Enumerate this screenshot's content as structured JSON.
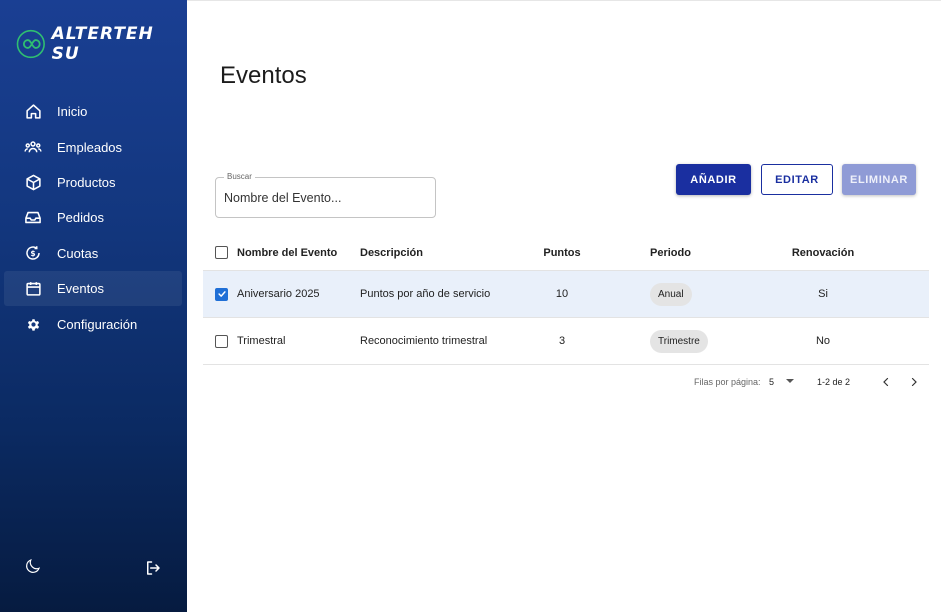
{
  "brand": {
    "name": "ALTERTEH SU",
    "accent": "#2fbf71"
  },
  "sidebar": {
    "items": [
      {
        "label": "Inicio",
        "icon": "home-icon"
      },
      {
        "label": "Empleados",
        "icon": "people-icon"
      },
      {
        "label": "Productos",
        "icon": "box-icon"
      },
      {
        "label": "Pedidos",
        "icon": "inbox-icon"
      },
      {
        "label": "Cuotas",
        "icon": "quota-icon"
      },
      {
        "label": "Eventos",
        "icon": "calendar-icon",
        "active": true
      },
      {
        "label": "Configuración",
        "icon": "gear-icon"
      }
    ],
    "bottom": {
      "theme_icon": "moon-icon",
      "logout_icon": "logout-icon"
    }
  },
  "main": {
    "title": "Eventos",
    "search": {
      "legend": "Buscar",
      "placeholder": "Nombre del Evento..."
    },
    "actions": {
      "add": "AÑADIR",
      "edit": "EDITAR",
      "delete": "ELIMINAR"
    },
    "table": {
      "columns": {
        "name": "Nombre del Evento",
        "description": "Descripción",
        "points": "Puntos",
        "period": "Periodo",
        "renewal": "Renovación"
      },
      "rows": [
        {
          "selected": true,
          "name": "Aniversario 2025",
          "description": "Puntos por año de servicio",
          "points": "10",
          "period": "Anual",
          "renewal": "Si"
        },
        {
          "selected": false,
          "name": "Trimestral",
          "description": "Reconocimiento trimestral",
          "points": "3",
          "period": "Trimestre",
          "renewal": "No"
        }
      ]
    },
    "pagination": {
      "rows_per_page_label": "Filas por página:",
      "rows_per_page": "5",
      "range": "1-2 de 2"
    }
  },
  "colors": {
    "primary": "#1a2fa0",
    "sidebar_top": "#1a3f93",
    "sidebar_bottom": "#061b40",
    "selected_row": "#e9f0fa",
    "checkbox": "#1f6fd6"
  }
}
